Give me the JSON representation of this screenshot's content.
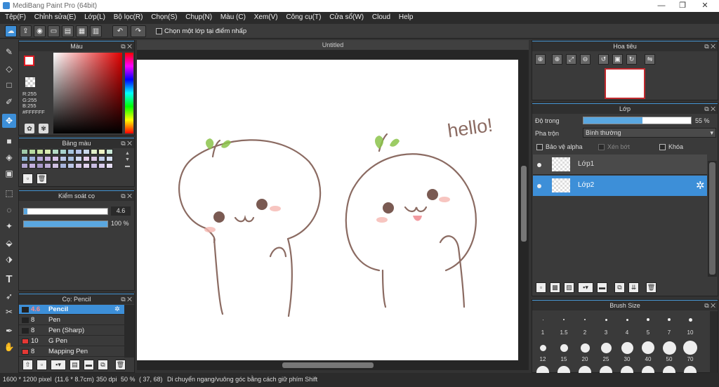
{
  "window": {
    "title": "MediBang Paint Pro (64bit)",
    "min": "—",
    "max": "❐",
    "close": "✕"
  },
  "menu": [
    "Tệp(F)",
    "Chỉnh sửa(E)",
    "Lớp(L)",
    "Bộ lọc(R)",
    "Chọn(S)",
    "Chụp(N)",
    "Màu (C)",
    "Xem(V)",
    "Công cụ(T)",
    "Cửa sổ(W)",
    "Cloud",
    "Help"
  ],
  "toolbar": {
    "select_layer_label": "Chọn một lớp tại điểm nhấp"
  },
  "color_panel": {
    "title": "Màu",
    "r": "R:255",
    "g": "G:255",
    "b": "B:255",
    "hex": "#FFFFFF",
    "primary": "#ffffff",
    "secondary": "#000000",
    "accent": "#e11a22"
  },
  "palette_panel": {
    "title": "Bảng màu"
  },
  "brush_control": {
    "title": "Kiểm soát cọ",
    "size": "4.6",
    "opacity": "100 %",
    "opacity_fraction": 1.0
  },
  "brush_panel": {
    "title": "Cọ: Pencil",
    "items": [
      {
        "size": "4.6",
        "name": "Pencil",
        "color": "#222222",
        "selected": true
      },
      {
        "size": "8",
        "name": "Pen",
        "color": "#222222"
      },
      {
        "size": "8",
        "name": "Pen (Sharp)",
        "color": "#222222"
      },
      {
        "size": "10",
        "name": "G Pen",
        "color": "#e53935"
      },
      {
        "size": "8",
        "name": "Mapping Pen",
        "color": "#e53935"
      }
    ]
  },
  "document": {
    "tab": "Untitled",
    "text": "hello!"
  },
  "navigator": {
    "title": "Hoa tiêu"
  },
  "layer_panel": {
    "title": "Lớp",
    "opacity_label": "Độ trong",
    "opacity_value": "55 %",
    "opacity_fraction": 0.55,
    "blend_label": "Pha trộn",
    "blend_value": "Bình thường",
    "protect_alpha": "Bảo vệ alpha",
    "clip": "Xén bớt",
    "lock": "Khóa",
    "layers": [
      {
        "name": "Lớp1",
        "selected": false
      },
      {
        "name": "Lớp2",
        "selected": true
      }
    ]
  },
  "brush_size": {
    "title": "Brush Size",
    "sizes": [
      "1",
      "1.5",
      "2",
      "3",
      "4",
      "5",
      "7",
      "10"
    ],
    "sizes2": [
      "12",
      "15",
      "20",
      "25",
      "30",
      "40",
      "50",
      "70"
    ]
  },
  "status": {
    "pixels": "1600 * 1200 pixel",
    "cm": "(11.6 * 8.7cm)",
    "dpi": "350 dpi",
    "zoom": "50 %",
    "coord": "( 37, 68)",
    "hint": "Di chuyển ngang/vuông góc bằng cách giữ phím Shift"
  }
}
